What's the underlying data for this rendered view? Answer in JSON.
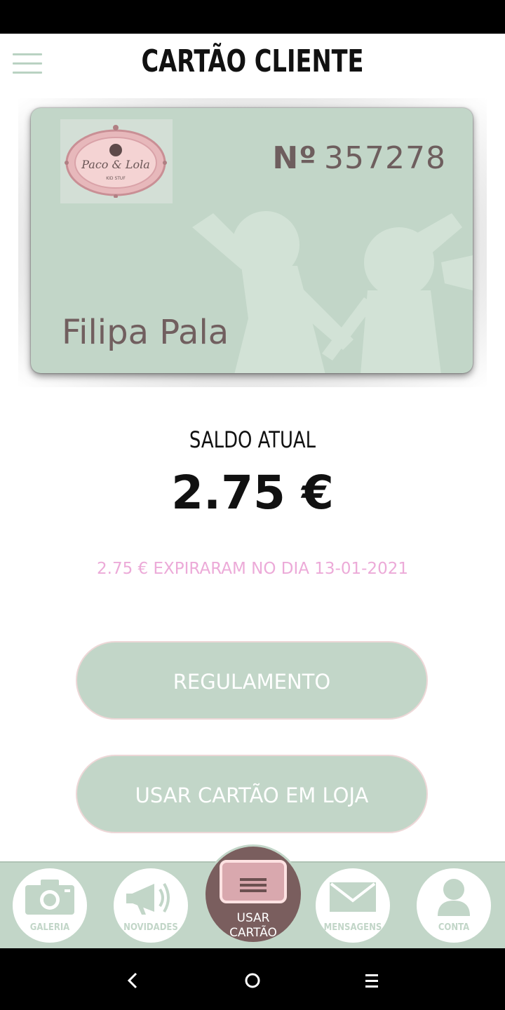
{
  "header": {
    "title": "CARTÃO CLIENTE",
    "menu_icon": "hamburger-menu-icon"
  },
  "card": {
    "brand_line1": "Paco & Lola",
    "brand_line2": "KID STUF",
    "number_prefix": "Nº",
    "number": "357278",
    "holder_name": "Filipa Pala"
  },
  "balance": {
    "label": "SALDO ATUAL",
    "value": "2.75 €",
    "expiry_notice": "2.75 € EXPIRARAM NO DIA 13-01-2021"
  },
  "buttons": {
    "regulamento": "REGULAMENTO",
    "usar_cartao": "USAR CARTÃO EM LOJA"
  },
  "tabbar": {
    "items": [
      {
        "label": "GALERIA",
        "icon": "camera-icon"
      },
      {
        "label": "NOVIDADES",
        "icon": "megaphone-icon"
      },
      {
        "label": "USAR\nCARTÃO",
        "icon": "card-icon",
        "active": true
      },
      {
        "label": "MENSAGENS",
        "icon": "envelope-icon"
      },
      {
        "label": "CONTA",
        "icon": "user-icon"
      }
    ]
  },
  "colors": {
    "sage": "#c2d6c8",
    "mauve": "#7a5e5e",
    "card_text": "#6e5e5e",
    "expiry_pink": "#ecaad8"
  },
  "system_nav": {
    "back": "back-icon",
    "home": "home-icon",
    "recents": "recents-icon"
  }
}
